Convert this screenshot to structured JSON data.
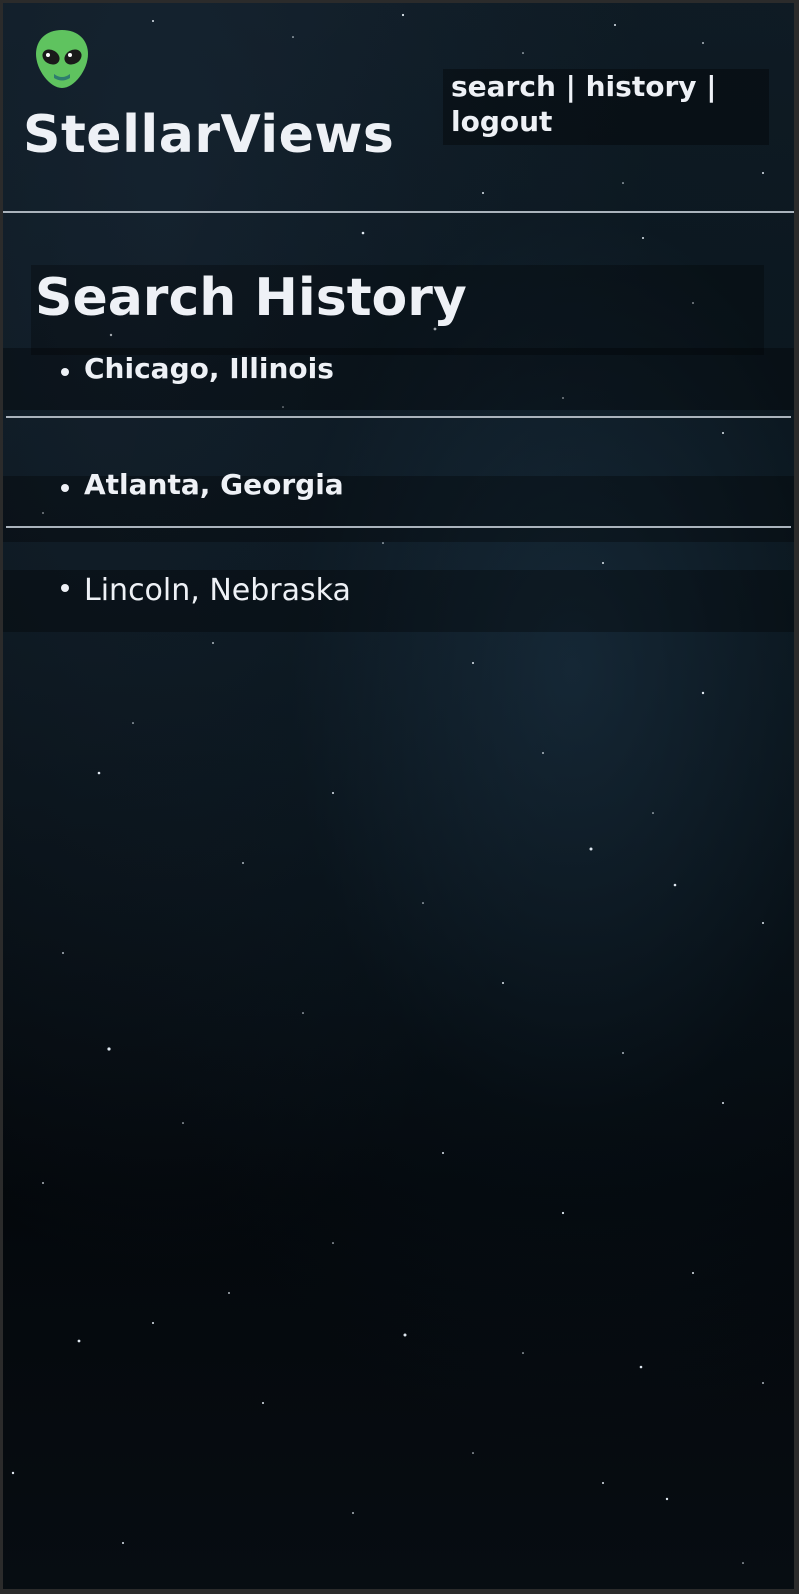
{
  "header": {
    "logo_icon": "alien-icon",
    "brand": "StellarViews",
    "nav": {
      "search_label": "search",
      "history_label": "history",
      "logout_label": "logout",
      "separator": "|"
    }
  },
  "main": {
    "title": "Search History",
    "history": [
      {
        "label": "Chicago, Illinois"
      },
      {
        "label": "Atlanta, Georgia"
      },
      {
        "label": "Lincoln, Nebraska"
      }
    ]
  },
  "colors": {
    "text": "#eef1f6",
    "rule": "#aab3bc",
    "alien_green": "#5fc35f",
    "background": "#0a141b"
  }
}
